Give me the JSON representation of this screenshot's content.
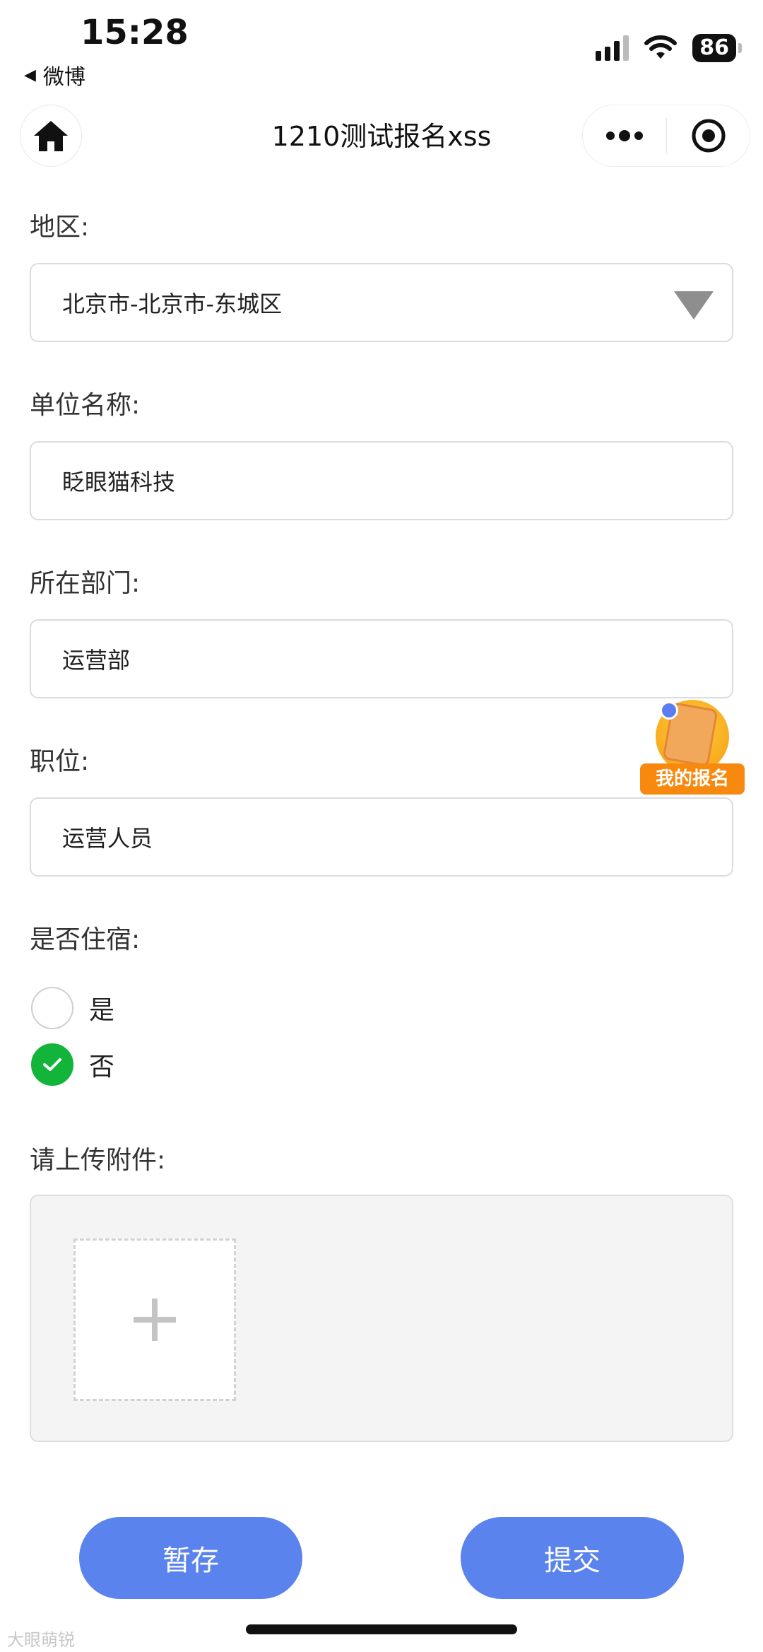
{
  "status_bar": {
    "time": "15:28",
    "back_app": "微博",
    "battery": "86"
  },
  "nav": {
    "title": "1210测试报名xss"
  },
  "form": {
    "region": {
      "label": "地区:",
      "value": "北京市-北京市-东城区"
    },
    "company": {
      "label": "单位名称:",
      "value": "眨眼猫科技"
    },
    "department": {
      "label": "所在部门:",
      "value": "运营部"
    },
    "position": {
      "label": "职位:",
      "value": "运营人员"
    },
    "accommodation": {
      "label": "是否住宿:",
      "options": [
        {
          "label": "是",
          "checked": false
        },
        {
          "label": "否",
          "checked": true
        }
      ]
    },
    "attachment": {
      "label": "请上传附件:"
    }
  },
  "float_badge": {
    "label": "我的报名"
  },
  "buttons": {
    "save": "暂存",
    "submit": "提交"
  },
  "watermark": "大眼萌锐"
}
